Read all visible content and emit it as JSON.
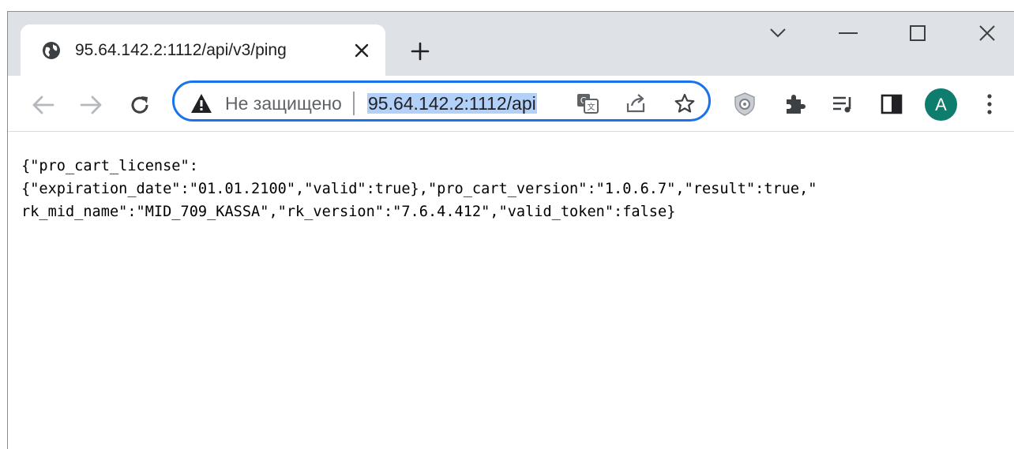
{
  "tab": {
    "title": "95.64.142.2:1112/api/v3/ping",
    "favicon": "globe-icon",
    "close_icon": "close-icon"
  },
  "tabstrip": {
    "new_tab_icon": "plus-icon"
  },
  "window_controls": [
    "chevron-down-icon",
    "minimize-icon",
    "maximize-icon",
    "close-icon"
  ],
  "navigation": {
    "back_icon": "arrow-left-icon",
    "forward_icon": "arrow-right-icon",
    "reload_icon": "reload-icon"
  },
  "omnibox": {
    "security_icon": "warning-icon",
    "security_label": "Не защищено",
    "url": "95.64.142.2:1112/api",
    "icons": [
      "translate-icon",
      "share-icon",
      "star-icon"
    ],
    "focus_color": "#1a73e8",
    "selection_color": "#b3d1f8"
  },
  "toolbar": {
    "icons": [
      "shield-extension-icon",
      "puzzle-icon",
      "media-queue-icon",
      "side-panel-icon",
      "kebab-menu-icon"
    ],
    "avatar_letter": "A",
    "avatar_color": "#0e7d6e"
  },
  "page": {
    "lines": [
      "{\"pro_cart_license\":",
      "{\"expiration_date\":\"01.01.2100\",\"valid\":true},\"pro_cart_version\":\"1.0.6.7\",\"result\":true,\"",
      "rk_mid_name\":\"MID_709_KASSA\",\"rk_version\":\"7.6.4.412\",\"valid_token\":false}"
    ]
  }
}
